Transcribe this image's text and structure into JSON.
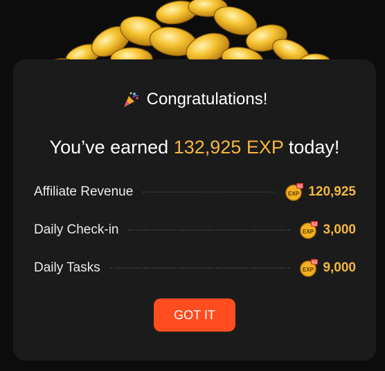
{
  "dialog": {
    "congrats_text": "Congratulations!",
    "headline_prefix": "You’ve earned",
    "headline_amount": "132,925 EXP",
    "headline_suffix": "today!",
    "badge_text": "EXP",
    "badge_corner": "S2",
    "rows": [
      {
        "label": "Affiliate Revenue",
        "value": "120,925"
      },
      {
        "label": "Daily Check-in",
        "value": "3,000"
      },
      {
        "label": "Daily Tasks",
        "value": "9,000"
      }
    ],
    "button_label": "GOT IT"
  },
  "colors": {
    "accent": "#f6b73c",
    "button": "#ff4d1f",
    "card_bg": "#1b1b1b",
    "page_bg": "#0c0c0c"
  },
  "icons": [
    "coin-pile-illustration",
    "party-popper-icon",
    "exp-badge-icon"
  ]
}
